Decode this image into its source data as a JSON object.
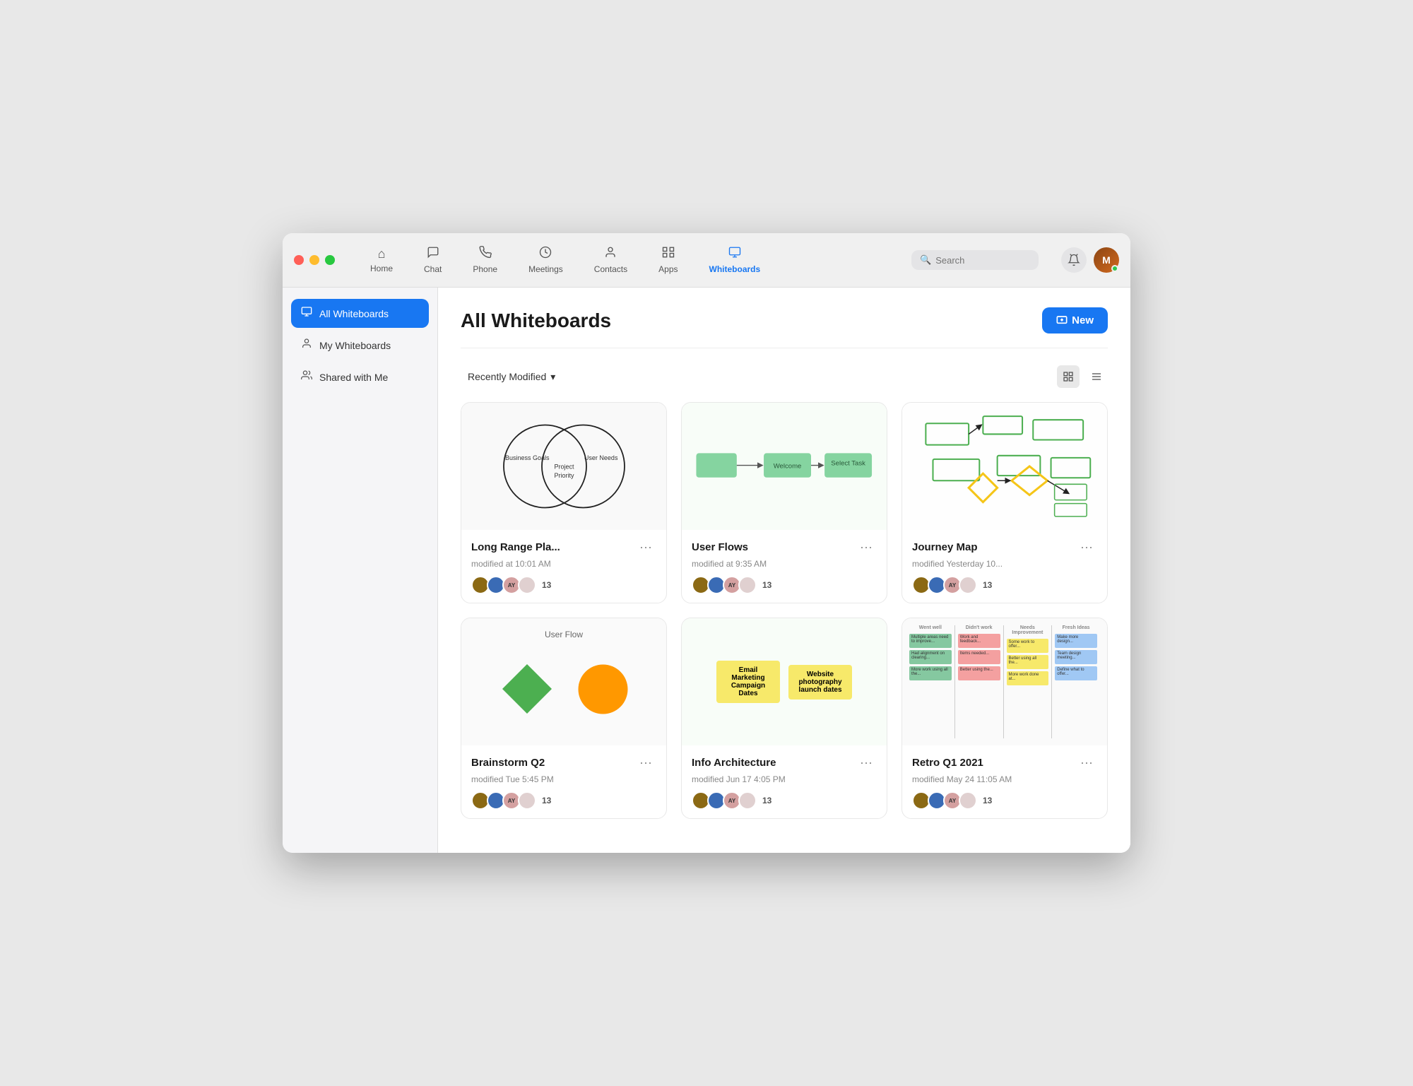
{
  "window": {
    "title": "Whiteboards"
  },
  "titlebar": {
    "traffic": [
      "red",
      "yellow",
      "green"
    ]
  },
  "nav": {
    "items": [
      {
        "id": "home",
        "label": "Home",
        "icon": "⌂",
        "active": false
      },
      {
        "id": "chat",
        "label": "Chat",
        "icon": "💬",
        "active": false
      },
      {
        "id": "phone",
        "label": "Phone",
        "icon": "📞",
        "active": false
      },
      {
        "id": "meetings",
        "label": "Meetings",
        "icon": "🕐",
        "active": false
      },
      {
        "id": "contacts",
        "label": "Contacts",
        "icon": "👤",
        "active": false
      },
      {
        "id": "apps",
        "label": "Apps",
        "icon": "⚡",
        "active": false
      },
      {
        "id": "whiteboards",
        "label": "Whiteboards",
        "icon": "🖥",
        "active": true
      }
    ],
    "search_placeholder": "Search",
    "user_initial": "M"
  },
  "sidebar": {
    "items": [
      {
        "id": "all",
        "label": "All Whiteboards",
        "icon": "🖥",
        "active": true
      },
      {
        "id": "my",
        "label": "My Whiteboards",
        "icon": "👤",
        "active": false
      },
      {
        "id": "shared",
        "label": "Shared with Me",
        "icon": "👥",
        "active": false
      }
    ]
  },
  "content": {
    "title": "All Whiteboards",
    "new_button": "New",
    "filter": {
      "label": "Recently Modified",
      "chevron": "▾"
    },
    "view_grid_icon": "⊞",
    "view_list_icon": "≡",
    "whiteboards": [
      {
        "id": "1",
        "title": "Long Range Pla...",
        "modified": "modified at 10:01 AM",
        "type": "venn",
        "avatar_count": "13"
      },
      {
        "id": "2",
        "title": "User Flows",
        "modified": "modified at 9:35 AM",
        "type": "flow",
        "avatar_count": "13"
      },
      {
        "id": "3",
        "title": "Journey Map",
        "modified": "modified Yesterday 10...",
        "type": "journey",
        "avatar_count": "13"
      },
      {
        "id": "4",
        "title": "Brainstorm Q2",
        "modified": "modified Tue 5:45 PM",
        "type": "brainstorm",
        "avatar_count": "13"
      },
      {
        "id": "5",
        "title": "Info Architecture",
        "modified": "modified Jun 17 4:05 PM",
        "type": "info",
        "avatar_count": "13"
      },
      {
        "id": "6",
        "title": "Retro Q1 2021",
        "modified": "modified May 24 11:05 AM",
        "type": "retro",
        "avatar_count": "13"
      }
    ],
    "avatars": [
      {
        "color": "#8B6914",
        "initials": ""
      },
      {
        "color": "#1877f2",
        "initials": ""
      },
      {
        "color": "#d4a0a0",
        "initials": "AY"
      },
      {
        "color": "#e0d0d0",
        "initials": ""
      }
    ]
  }
}
